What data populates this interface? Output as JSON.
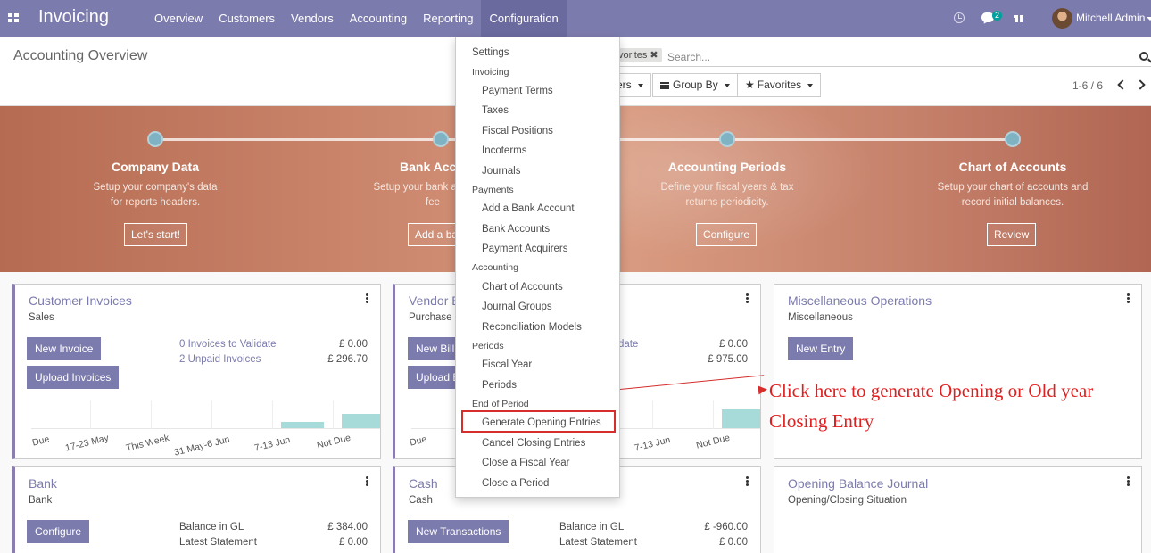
{
  "navbar": {
    "brand": "Invoicing",
    "menu": [
      "Overview",
      "Customers",
      "Vendors",
      "Accounting",
      "Reporting",
      "Configuration"
    ],
    "active_menu": "Configuration",
    "chat_badge": "2",
    "user_name": "Mitchell Admin",
    "icons": [
      "apps-icon",
      "clock-icon",
      "chat-icon",
      "gift-icon",
      "avatar"
    ]
  },
  "control_panel": {
    "title": "Accounting Overview",
    "facet_label": "vorites",
    "search_placeholder": "Search...",
    "filters_label": "ers",
    "group_by_label": "Group By",
    "favorites_label": "Favorites",
    "pager": "1-6 / 6"
  },
  "onboarding": {
    "steps": [
      {
        "title": "Company Data",
        "desc": "Setup your company's data for reports headers.",
        "button": "Let's start!"
      },
      {
        "title": "Bank Acc",
        "desc": "Setup your bank acc bank fee",
        "button": "Add a ba"
      },
      {
        "title": "Accounting Periods",
        "desc": "Define your fiscal years & tax returns periodicity.",
        "button": "Configure"
      },
      {
        "title": "Chart of Accounts",
        "desc": "Setup your chart of accounts and record initial balances.",
        "button": "Review"
      }
    ]
  },
  "cards": {
    "customer_invoices": {
      "title": "Customer Invoices",
      "sub": "Sales",
      "btn1": "New Invoice",
      "btn2": "Upload Invoices",
      "link1": "0 Invoices to Validate",
      "link2": "2 Unpaid Invoices",
      "val1": "£ 0.00",
      "val2": "£ 296.70",
      "ticks": [
        "Due",
        "17-23 May",
        "This Week",
        "31 May-6 Jun",
        "7-13 Jun",
        "Not Due"
      ],
      "bars": [
        0,
        0,
        0,
        0,
        0.35,
        0.75
      ]
    },
    "vendor_bills": {
      "title": "Vendor B",
      "sub": "Purchase",
      "btn1": "New Bill",
      "btn2": "Upload B",
      "link1": "date",
      "val1": "£ 0.00",
      "val2": "£ 975.00",
      "ticks": [
        "Due",
        "7-13 Jun",
        "Not Due"
      ],
      "bars": [
        0,
        0,
        0,
        0,
        0,
        1.0
      ]
    },
    "misc": {
      "title": "Miscellaneous Operations",
      "sub": "Miscellaneous",
      "btn1": "New Entry"
    },
    "bank": {
      "title": "Bank",
      "sub": "Bank",
      "btn1": "Configure",
      "label1": "Balance in GL",
      "label2": "Latest Statement",
      "val1": "£ 384.00",
      "val2": "£ 0.00"
    },
    "cash": {
      "title": "Cash",
      "sub": "Cash",
      "btn1": "New Transactions",
      "label1": "Balance in GL",
      "label2": "Latest Statement",
      "val1": "£ -960.00",
      "val2": "£ 0.00"
    },
    "opening": {
      "title": "Opening Balance Journal",
      "sub": "Opening/Closing Situation"
    }
  },
  "dropdown": {
    "settings": "Settings",
    "invoicing_header": "Invoicing",
    "invoicing": [
      "Payment Terms",
      "Taxes",
      "Fiscal Positions",
      "Incoterms",
      "Journals"
    ],
    "payments_header": "Payments",
    "payments": [
      "Add a Bank Account",
      "Bank Accounts",
      "Payment Acquirers"
    ],
    "accounting_header": "Accounting",
    "accounting": [
      "Chart of Accounts",
      "Journal Groups",
      "Reconciliation Models"
    ],
    "periods_header": "Periods",
    "periods": [
      "Fiscal Year",
      "Periods"
    ],
    "end_header": "End of Period",
    "end": [
      "Generate Opening Entries",
      "Cancel Closing Entries",
      "Close a Fiscal Year",
      "Close a Period"
    ]
  },
  "annotation": {
    "text": "Click here to generate Opening or Old year Closing Entry",
    "color": "#e02020"
  },
  "colors": {
    "navbar": "#7c7bad",
    "primary": "#7c7bad",
    "bar": "#a6dbd9",
    "highlight": "#d62d2d"
  }
}
